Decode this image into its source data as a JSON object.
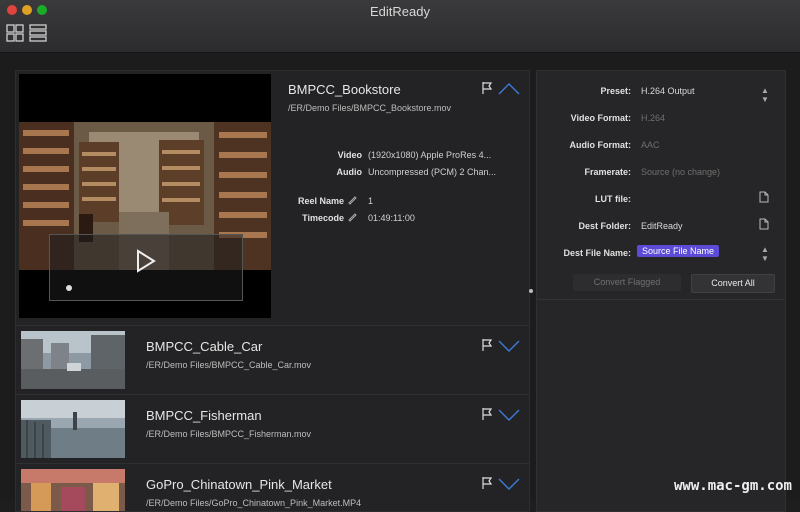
{
  "window": {
    "title": "EditReady"
  },
  "toolbar": {
    "grid_view": "grid-view-icon",
    "list_view": "list-view-icon"
  },
  "selected": {
    "title": "BMPCC_Bookstore",
    "path": "/ER/Demo Files/BMPCC_Bookstore.mov",
    "video_label": "Video",
    "video_value": "(1920x1080) Apple ProRes 4...",
    "audio_label": "Audio",
    "audio_value": "Uncompressed (PCM) 2 Chan...",
    "reel_label": "Reel Name",
    "reel_value": "1",
    "timecode_label": "Timecode",
    "timecode_value": "01:49:11:00"
  },
  "items": [
    {
      "title": "BMPCC_Cable_Car",
      "path": "/ER/Demo Files/BMPCC_Cable_Car.mov"
    },
    {
      "title": "BMPCC_Fisherman",
      "path": "/ER/Demo Files/BMPCC_Fisherman.mov"
    },
    {
      "title": "GoPro_Chinatown_Pink_Market",
      "path": "/ER/Demo Files/GoPro_Chinatown_Pink_Market.MP4"
    }
  ],
  "settings": {
    "preset_label": "Preset:",
    "preset_value": "H.264 Output",
    "video_format_label": "Video Format:",
    "video_format_value": "H.264",
    "audio_format_label": "Audio Format:",
    "audio_format_value": "AAC",
    "framerate_label": "Framerate:",
    "framerate_value": "Source (no change)",
    "lut_label": "LUT file:",
    "lut_value": "",
    "dest_folder_label": "Dest Folder:",
    "dest_folder_value": "EditReady",
    "dest_file_label": "Dest File Name:",
    "dest_file_value": "Source File Name",
    "convert_flagged": "Convert Flagged",
    "convert_all": "Convert All"
  },
  "watermark": "www.mac-gm.com"
}
